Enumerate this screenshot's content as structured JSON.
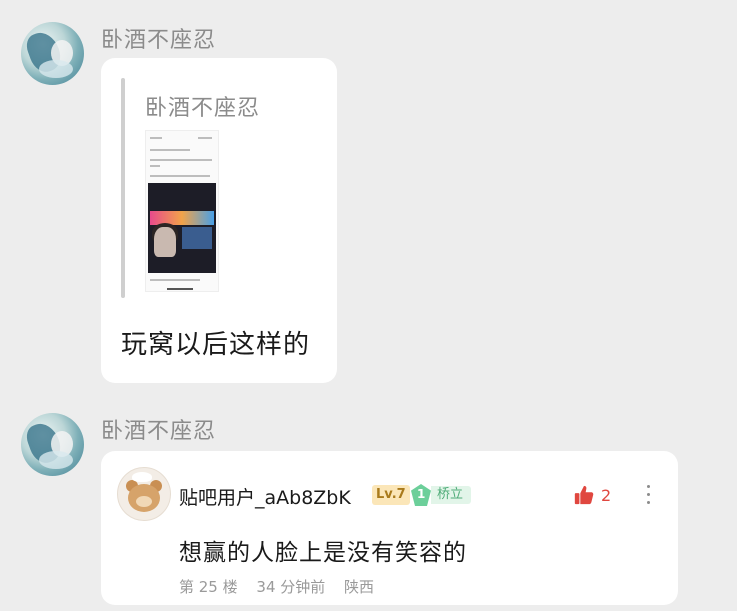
{
  "messages": [
    {
      "sender": "卧酒不座忍",
      "quote": {
        "sender": "卧酒不座忍",
        "image": "screenshot-thumbnail"
      },
      "text": "玩窝以后这样的"
    },
    {
      "sender": "卧酒不座忍",
      "comment": {
        "user": "贴吧用户_aAb8ZbK",
        "level": "Lv.7",
        "badge_level": "1",
        "badge_title": "桥立",
        "likes": "2",
        "text": "想赢的人脸上是没有笑容的",
        "floor": "第 25 楼",
        "time": "34 分钟前",
        "location": "陕西"
      }
    }
  ],
  "colors": {
    "background": "#ededed",
    "bubble": "#ffffff",
    "like": "#e0473f",
    "level_badge": "#fbe6b8",
    "title_badge": "#6ccf9a"
  },
  "icons": [
    "avatar-landscape",
    "bear-avatar",
    "thumbs-up-icon",
    "more-vertical-icon",
    "gem-icon"
  ]
}
